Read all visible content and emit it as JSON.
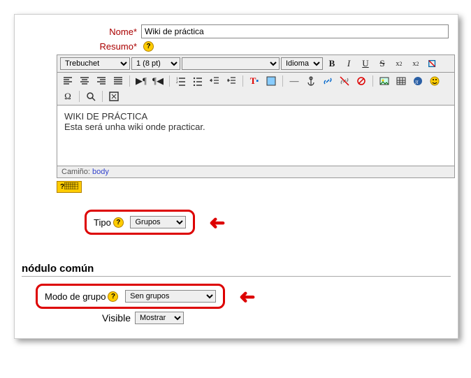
{
  "form": {
    "nome_label": "Nome",
    "nome_value": "Wiki de práctica",
    "resumo_label": "Resumo"
  },
  "editor": {
    "font": "Trebuchet",
    "size": "1 (8 pt)",
    "style_blank": " ",
    "lang": "Idioma",
    "content_line1": "WIKI DE PRÁCTICA",
    "content_line2": "Esta será unha wiki onde practicar.",
    "path_label": "Camiño:",
    "path_value": "body"
  },
  "tipo": {
    "label": "Tipo",
    "value": "Grupos"
  },
  "section": {
    "title": "nódulo común"
  },
  "modo": {
    "label": "Modo de grupo",
    "value": "Sen grupos"
  },
  "visible": {
    "label": "Visible",
    "value": "Mostrar"
  }
}
